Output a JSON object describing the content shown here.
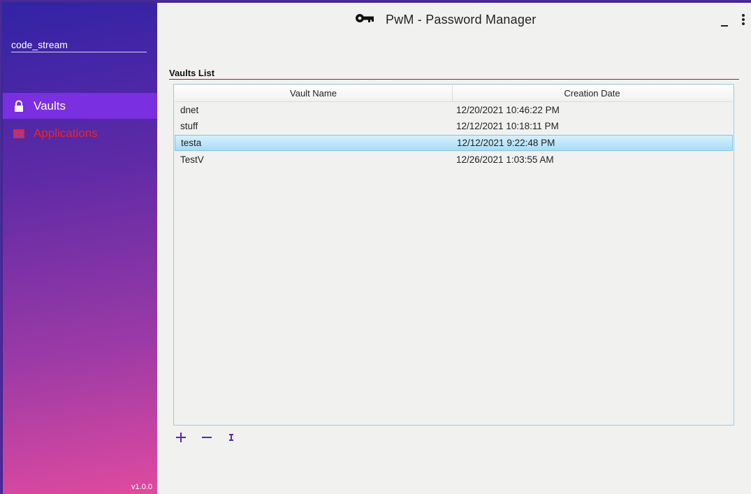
{
  "app": {
    "title": "PwM - Password Manager"
  },
  "sidebar": {
    "username": "code_stream",
    "items": [
      {
        "label": "Vaults",
        "icon": "lock-icon",
        "active": true
      },
      {
        "label": "Applications",
        "icon": "app-window-icon",
        "active": false
      }
    ],
    "version": "v1.0.0"
  },
  "main": {
    "section_title": "Vaults List",
    "table": {
      "columns": [
        "Vault Name",
        "Creation Date"
      ],
      "rows": [
        {
          "name": "dnet",
          "date": "12/20/2021 10:46:22 PM",
          "selected": false
        },
        {
          "name": "stuff",
          "date": "12/12/2021 10:18:11 PM",
          "selected": false
        },
        {
          "name": "testa",
          "date": "12/12/2021 9:22:48 PM",
          "selected": true
        },
        {
          "name": "TestV",
          "date": "12/26/2021 1:03:55 AM",
          "selected": false
        }
      ]
    },
    "actions": [
      "add-icon",
      "remove-icon",
      "edit-icon"
    ]
  },
  "colors": {
    "accent": "#7a2fe0",
    "danger": "#e5262c",
    "selection": "#a9dcf6",
    "section_rule": "#b2162a"
  }
}
